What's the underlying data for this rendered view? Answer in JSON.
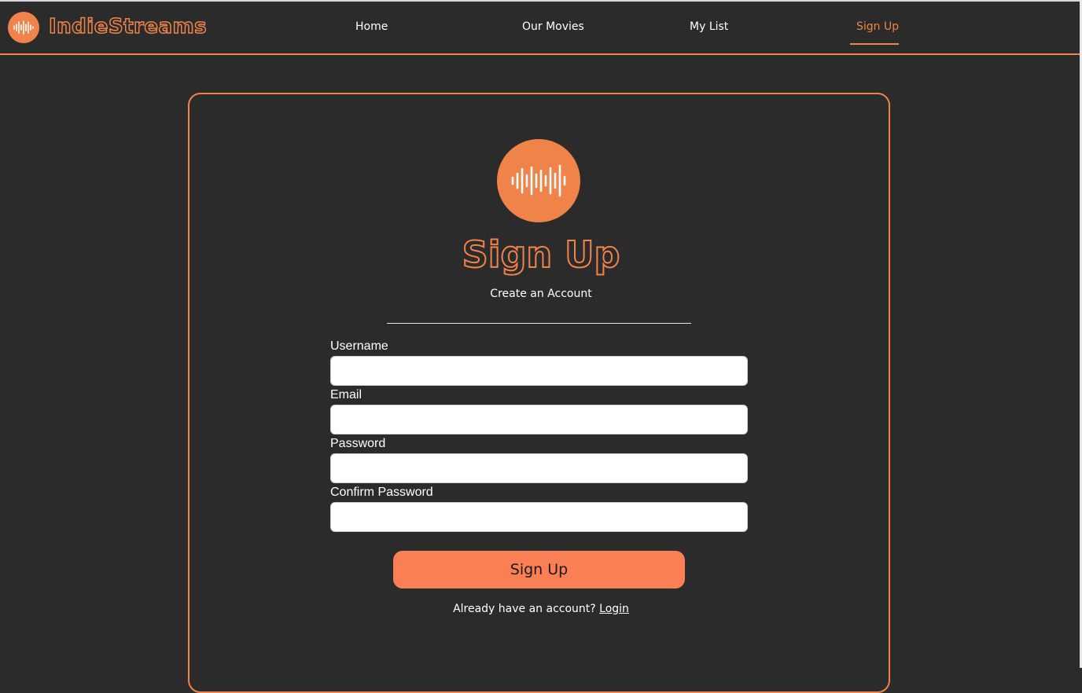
{
  "header": {
    "brand": "IndieStreams",
    "nav": [
      {
        "label": "Home"
      },
      {
        "label": "Our Movies"
      },
      {
        "label": "My List"
      },
      {
        "label": "Sign Up"
      }
    ],
    "active": "Sign Up"
  },
  "card": {
    "title": "Sign Up",
    "subtitle": "Create an Account",
    "fields": [
      {
        "label": "Username",
        "value": "",
        "placeholder": ""
      },
      {
        "label": "Email",
        "value": "",
        "placeholder": ""
      },
      {
        "label": "Password",
        "value": "",
        "placeholder": ""
      },
      {
        "label": "Confirm Password",
        "value": "",
        "placeholder": ""
      }
    ],
    "submit_label": "Sign Up",
    "login_prompt": "Already have an account?",
    "login_link": "Login"
  },
  "colors": {
    "accent": "#f0834a",
    "button": "#fb7f55",
    "background": "#2b2b2b"
  },
  "icons": {
    "logo": "soundwave-icon"
  }
}
